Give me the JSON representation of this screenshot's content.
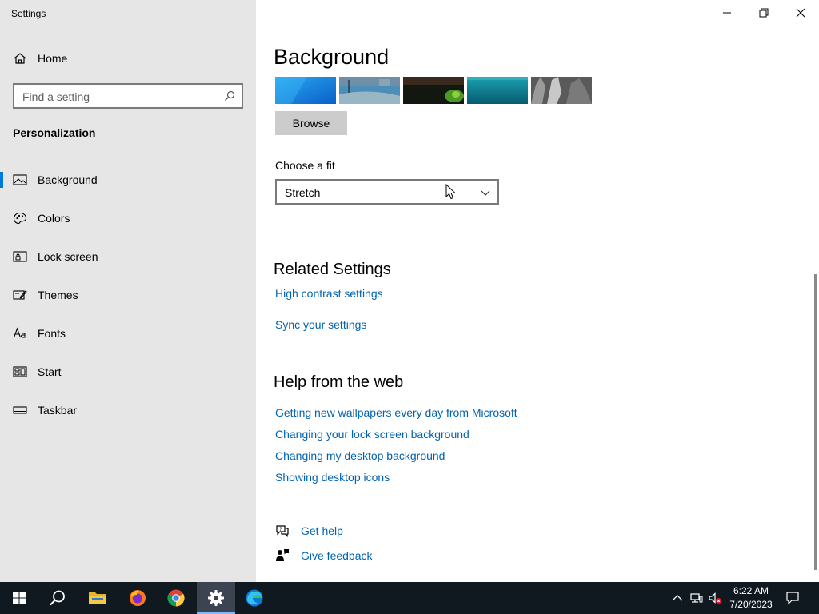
{
  "window": {
    "title": "Settings",
    "controls": [
      "minimize",
      "restore",
      "close"
    ]
  },
  "sidebar": {
    "home_label": "Home",
    "search_placeholder": "Find a setting",
    "section_title": "Personalization",
    "items": [
      {
        "label": "Background",
        "icon": "picture-icon",
        "selected": true
      },
      {
        "label": "Colors",
        "icon": "palette-icon",
        "selected": false
      },
      {
        "label": "Lock screen",
        "icon": "lock-screen-icon",
        "selected": false
      },
      {
        "label": "Themes",
        "icon": "themes-icon",
        "selected": false
      },
      {
        "label": "Fonts",
        "icon": "fonts-icon",
        "selected": false
      },
      {
        "label": "Start",
        "icon": "start-icon",
        "selected": false
      },
      {
        "label": "Taskbar",
        "icon": "taskbar-icon",
        "selected": false
      }
    ]
  },
  "main": {
    "page_title": "Background",
    "browse_label": "Browse",
    "fit": {
      "label": "Choose a fit",
      "value": "Stretch"
    },
    "related": {
      "title": "Related Settings",
      "links": [
        "High contrast settings",
        "Sync your settings"
      ]
    },
    "help": {
      "title": "Help from the web",
      "links": [
        "Getting new wallpapers every day from Microsoft",
        "Changing your lock screen background",
        "Changing my desktop background",
        "Showing desktop icons"
      ]
    },
    "get_help": "Get help",
    "give_feedback": "Give feedback"
  },
  "taskbar": {
    "apps": [
      "start",
      "search",
      "file-explorer",
      "firefox",
      "chrome",
      "settings",
      "edge"
    ],
    "active_app": "settings",
    "time": "6:22 AM",
    "date": "7/20/2023"
  },
  "colors": {
    "accent": "#0078d7",
    "link": "#0063b1",
    "sidebar_bg": "#e6e6e6",
    "taskbar_bg": "#101820"
  }
}
